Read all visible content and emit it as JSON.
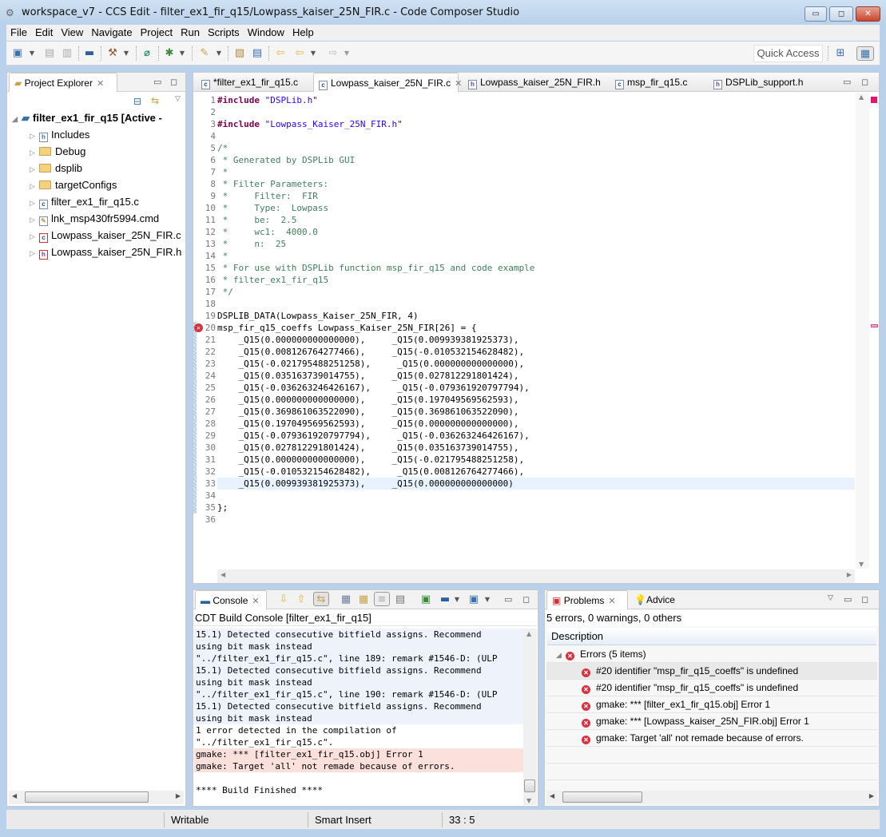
{
  "window": {
    "title": "workspace_v7 - CCS Edit - filter_ex1_fir_q15/Lowpass_kaiser_25N_FIR.c - Code Composer Studio",
    "minimize": "▭",
    "maximize": "◻",
    "close": "✕"
  },
  "menu": [
    "File",
    "Edit",
    "View",
    "Navigate",
    "Project",
    "Run",
    "Scripts",
    "Window",
    "Help"
  ],
  "toolbar": {
    "quick_access": "Quick Access",
    "icons": [
      "new-icon",
      "save-icon",
      "save-all-icon",
      "terminal-icon",
      "build-hammer-icon",
      "search-icon",
      "debug-bug-icon",
      "pencil-icon",
      "open-task-icon",
      "properties-icon",
      "last-edit-icon",
      "back-icon",
      "forward-icon"
    ]
  },
  "project_explorer": {
    "tab_label": "Project Explorer",
    "project": "filter_ex1_fir_q15  [Active -",
    "items": [
      {
        "label": "Includes",
        "type": "includes"
      },
      {
        "label": "Debug",
        "type": "folder"
      },
      {
        "label": "dsplib",
        "type": "folder"
      },
      {
        "label": "targetConfigs",
        "type": "folder"
      },
      {
        "label": "filter_ex1_fir_q15.c",
        "type": "c"
      },
      {
        "label": "lnk_msp430fr5994.cmd",
        "type": "cmd"
      },
      {
        "label": "Lowpass_kaiser_25N_FIR.c",
        "type": "c-error"
      },
      {
        "label": "Lowpass_kaiser_25N_FIR.h",
        "type": "h-error"
      }
    ]
  },
  "editor": {
    "tabs": [
      {
        "label": "*filter_ex1_fir_q15.c",
        "icon": "c"
      },
      {
        "label": "Lowpass_kaiser_25N_FIR.c",
        "icon": "c",
        "active": true
      },
      {
        "label": "Lowpass_kaiser_25N_FIR.h",
        "icon": "h"
      },
      {
        "label": "msp_fir_q15.c",
        "icon": "c"
      },
      {
        "label": "DSPLib_support.h",
        "icon": "h"
      }
    ],
    "error_line": 20,
    "current_line": 33,
    "lines": [
      "#include \"DSPLib.h\"",
      "",
      "#include \"Lowpass_Kaiser_25N_FIR.h\"",
      "",
      "/*",
      " * Generated by DSPLib GUI",
      " *",
      " * Filter Parameters:",
      " *     Filter:  FIR",
      " *     Type:  Lowpass",
      " *     be:  2.5",
      " *     wc1:  4000.0",
      " *     n:  25",
      " *",
      " * For use with DSPLib function msp_fir_q15 and code example",
      " * filter_ex1_fir_q15",
      " */",
      "",
      "DSPLIB_DATA(Lowpass_Kaiser_25N_FIR, 4)",
      "msp_fir_q15_coeffs Lowpass_Kaiser_25N_FIR[26] = {",
      "    _Q15(0.000000000000000),     _Q15(0.009939381925373),",
      "    _Q15(0.008126764277466),     _Q15(-0.010532154628482),",
      "    _Q15(-0.021795488251258),     _Q15(0.000000000000000),",
      "    _Q15(0.035163739014755),     _Q15(0.027812291801424),",
      "    _Q15(-0.036263246426167),     _Q15(-0.079361920797794),",
      "    _Q15(0.000000000000000),     _Q15(0.197049569562593),",
      "    _Q15(0.369861063522090),     _Q15(0.369861063522090),",
      "    _Q15(0.197049569562593),     _Q15(0.000000000000000),",
      "    _Q15(-0.079361920797794),     _Q15(-0.036263246426167),",
      "    _Q15(0.027812291801424),     _Q15(0.035163739014755),",
      "    _Q15(0.000000000000000),     _Q15(-0.021795488251258),",
      "    _Q15(-0.010532154628482),     _Q15(0.008126764277466),",
      "    _Q15(0.009939381925373),     _Q15(0.000000000000000)",
      "",
      "};",
      ""
    ]
  },
  "console": {
    "tab_label": "Console",
    "header": "CDT Build Console [filter_ex1_fir_q15]",
    "lines": [
      {
        "text": "15.1) Detected consecutive bitfield assigns. Recommend",
        "kind": "remark"
      },
      {
        "text": "using bit mask instead",
        "kind": "remark"
      },
      {
        "text": "\"../filter_ex1_fir_q15.c\", line 189: remark #1546-D: (ULP",
        "kind": "remark"
      },
      {
        "text": "15.1) Detected consecutive bitfield assigns. Recommend",
        "kind": "remark"
      },
      {
        "text": "using bit mask instead",
        "kind": "remark"
      },
      {
        "text": "\"../filter_ex1_fir_q15.c\", line 190: remark #1546-D: (ULP",
        "kind": "remark"
      },
      {
        "text": "15.1) Detected consecutive bitfield assigns. Recommend",
        "kind": "remark"
      },
      {
        "text": "using bit mask instead",
        "kind": "remark"
      },
      {
        "text": "1 error detected in the compilation of",
        "kind": "info"
      },
      {
        "text": "\"../filter_ex1_fir_q15.c\".",
        "kind": "info"
      },
      {
        "text": "gmake: *** [filter_ex1_fir_q15.obj] Error 1",
        "kind": "error"
      },
      {
        "text": "gmake: Target 'all' not remade because of errors.",
        "kind": "error"
      },
      {
        "text": "",
        "kind": "info"
      },
      {
        "text": "**** Build Finished ****",
        "kind": "info"
      }
    ]
  },
  "problems": {
    "tab_label": "Problems",
    "advice_label": "Advice",
    "summary": "5 errors, 0 warnings, 0 others",
    "column": "Description",
    "group": "Errors (5 items)",
    "items": [
      "#20 identifier \"msp_fir_q15_coeffs\" is undefined",
      "#20 identifier \"msp_fir_q15_coeffs\" is undefined",
      "gmake: *** [filter_ex1_fir_q15.obj] Error 1",
      "gmake: *** [Lowpass_kaiser_25N_FIR.obj] Error 1",
      "gmake: Target 'all' not remade because of errors."
    ]
  },
  "status_bar": {
    "writable": "Writable",
    "insert_mode": "Smart Insert",
    "position": "33 : 5"
  },
  "colors": {
    "keyword": "#7f0055",
    "string": "#2a00ff",
    "comment": "#3f7f5f",
    "error": "#d4333f",
    "console_error_bg": "#fbe0dc",
    "console_remark_bg": "#eef3fb"
  }
}
